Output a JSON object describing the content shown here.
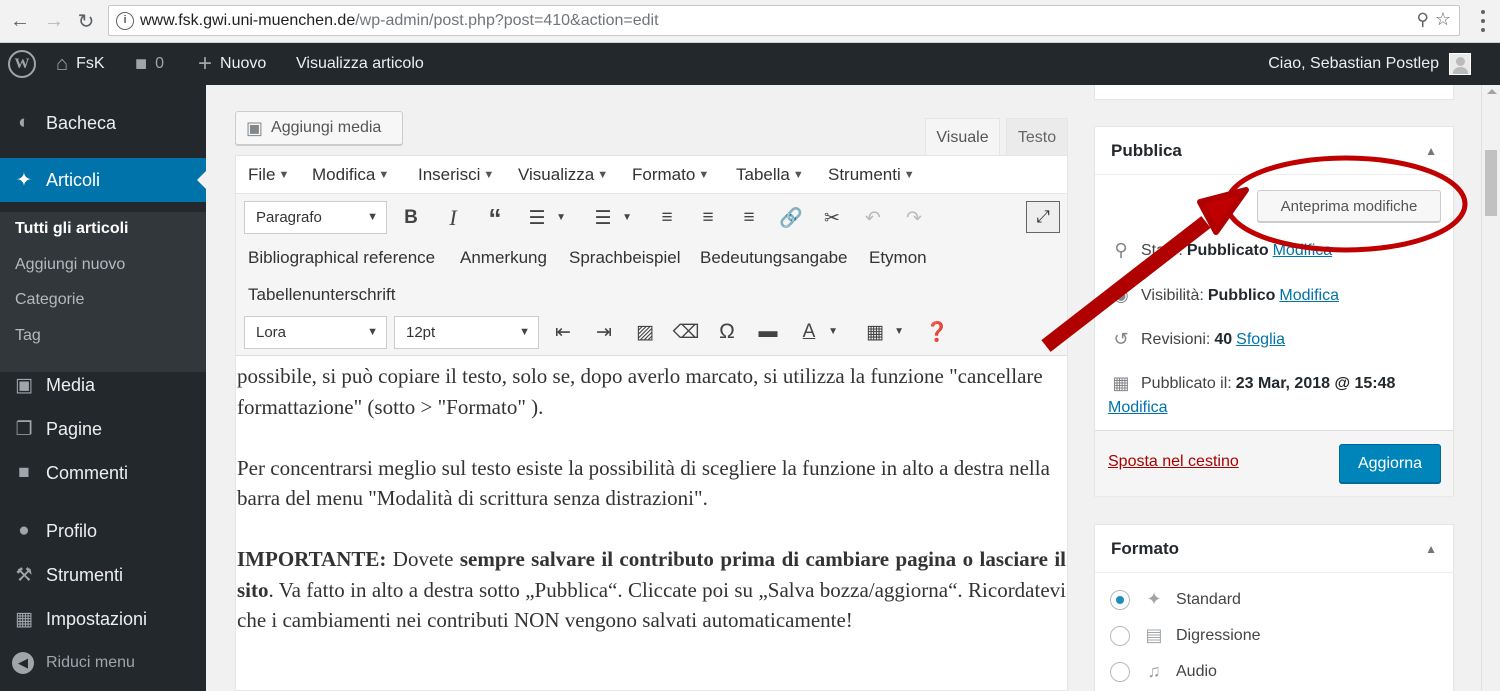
{
  "browser": {
    "url_host": "www.fsk.gwi.uni-muenchen.de",
    "url_path": "/wp-admin/post.php?post=410&action=edit"
  },
  "adminbar": {
    "site_name": "FsK",
    "comments_count": "0",
    "new_label": "Nuovo",
    "view_post": "Visualizza articolo",
    "greeting": "Ciao, Sebastian Postlep"
  },
  "sidebar": {
    "items": [
      {
        "label": "Bacheca"
      },
      {
        "label": "Articoli"
      },
      {
        "label": "Media"
      },
      {
        "label": "Pagine"
      },
      {
        "label": "Commenti"
      },
      {
        "label": "Profilo"
      },
      {
        "label": "Strumenti"
      },
      {
        "label": "Impostazioni"
      }
    ],
    "submenu": [
      "Tutti gli articoli",
      "Aggiungi nuovo",
      "Categorie",
      "Tag"
    ],
    "collapse": "Riduci menu"
  },
  "editor": {
    "add_media": "Aggiungi media",
    "tab_visual": "Visuale",
    "tab_text": "Testo",
    "menus": [
      "File",
      "Modifica",
      "Inserisci",
      "Visualizza",
      "Formato",
      "Tabella",
      "Strumenti"
    ],
    "block_format": "Paragrafo",
    "font_family": "Lora",
    "font_size": "12pt",
    "custom_buttons": [
      "Bibliographical reference",
      "Anmerkung",
      "Sprachbeispiel",
      "Bedeutungsangabe",
      "Etymon",
      "Tabellenunterschrift"
    ],
    "content": {
      "p1": "possibile, si può copiare il testo, solo se, dopo averlo marcato, si utilizza la funzione \"cancellare formattazione\" (sotto > \"Formato\" ).",
      "p2": "Per concentrarsi meglio sul testo esiste la possibilità di scegliere la funzione in alto a destra nella barra del menu \"Modalità di scrittura senza distrazioni\".",
      "p3_b1": "IMPORTANTE:",
      "p3_t1": " Dovete ",
      "p3_b2": "sempre salvare il contributo prima di cambiare pagina o lasciare il sito",
      "p3_t2": ". Va fatto in alto a destra sotto „Pubblica“. Cliccate poi su „Salva bozza/aggiorna“. Ricordatevi che i cambiamenti nei contributi NON vengono salvati automaticamente!"
    }
  },
  "publish": {
    "title": "Pubblica",
    "preview_button": "Anteprima modifiche",
    "status_label": "Stato:",
    "status_value": "Pubblicato",
    "visibility_label": "Visibilità:",
    "visibility_value": "Pubblico",
    "revisions_label": "Revisioni:",
    "revisions_value": "40",
    "revisions_link": "Sfoglia",
    "published_label": "Pubblicato il:",
    "published_value": "23 Mar, 2018 @ 15:48",
    "edit_link": "Modifica",
    "trash": "Sposta nel cestino",
    "update_button": "Aggiorna"
  },
  "format_box": {
    "title": "Formato",
    "options": [
      "Standard",
      "Digressione",
      "Audio"
    ],
    "selected": "Standard"
  },
  "colors": {
    "admin_dark": "#23282d",
    "accent_blue": "#0073aa",
    "button_blue": "#0085ba",
    "annotation_red": "#c00000"
  }
}
